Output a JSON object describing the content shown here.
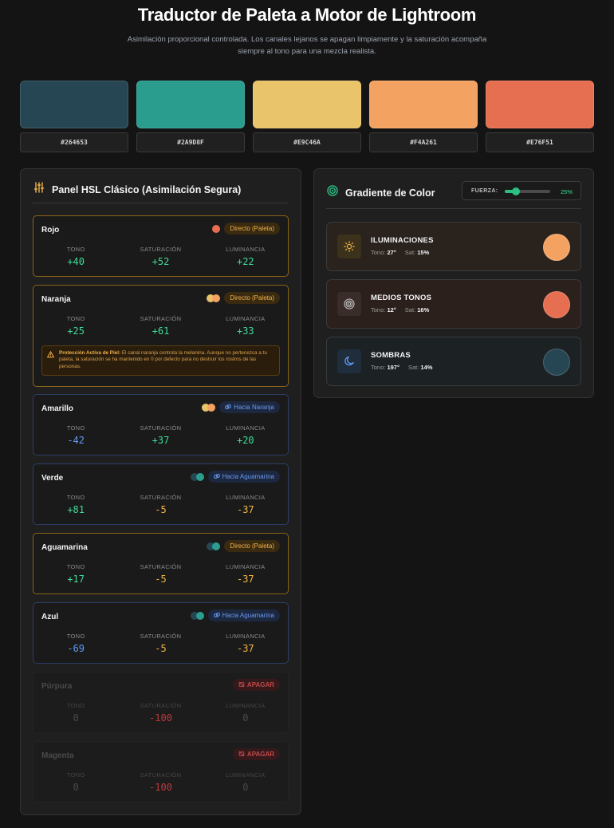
{
  "header": {
    "title": "Traductor de Paleta a Motor de Lightroom",
    "subtitle": "Asimilación proporcional controlada. Los canales lejanos se apagan limpiamente y la saturación acompaña siempre al tono para una mezcla realista."
  },
  "palette": [
    {
      "hex": "#264653",
      "color": "#264653"
    },
    {
      "hex": "#2A9D8F",
      "color": "#2A9D8F"
    },
    {
      "hex": "#E9C46A",
      "color": "#E9C46A"
    },
    {
      "hex": "#F4A261",
      "color": "#F4A261"
    },
    {
      "hex": "#E76F51",
      "color": "#E76F51"
    }
  ],
  "hsl_panel": {
    "title": "Panel HSL Clásico (Asimilación Segura)",
    "col_labels": {
      "hue": "TONO",
      "sat": "SATURACIÓN",
      "lum": "LUMINANCIA"
    },
    "channels": [
      {
        "name": "Rojo",
        "badge": "Directo (Paleta)",
        "state": "direct",
        "hue": "+40",
        "sat": "+52",
        "lum": "+22",
        "dots": [
          "#E76F51"
        ]
      },
      {
        "name": "Naranja",
        "badge": "Directo (Paleta)",
        "state": "direct",
        "hue": "+25",
        "sat": "+61",
        "lum": "+33",
        "dots": [
          "#E9C46A",
          "#F4A261"
        ],
        "warning_title": "Protección Activa de Piel:",
        "warning_text": " El canal naranja controla la melanina. Aunque no pertenezca a tu paleta, la saturación se ha mantenido en 0 por defecto para no destruir los rostros de las personas."
      },
      {
        "name": "Amarillo",
        "badge": "Hacia Naranja",
        "state": "toward",
        "hue": "-42",
        "sat": "+37",
        "lum": "+20",
        "dots": [
          "#E9C46A",
          "#F4A261"
        ]
      },
      {
        "name": "Verde",
        "badge": "Hacia Aguamarina",
        "state": "toward",
        "hue": "+81",
        "sat": "-5",
        "lum": "-37",
        "dots": [
          "#264653",
          "#2A9D8F"
        ]
      },
      {
        "name": "Aguamarina",
        "badge": "Directo (Paleta)",
        "state": "direct",
        "hue": "+17",
        "sat": "-5",
        "lum": "-37",
        "dots": [
          "#264653",
          "#2A9D8F"
        ]
      },
      {
        "name": "Azul",
        "badge": "Hacia Aguamarina",
        "state": "toward",
        "hue": "-69",
        "sat": "-5",
        "lum": "-37",
        "dots": [
          "#264653",
          "#2A9D8F"
        ]
      },
      {
        "name": "Púrpura",
        "badge": "APAGAR",
        "state": "off",
        "hue": "0",
        "sat": "-100",
        "lum": "0",
        "dots": []
      },
      {
        "name": "Magenta",
        "badge": "APAGAR",
        "state": "off",
        "hue": "0",
        "sat": "-100",
        "lum": "0",
        "dots": []
      }
    ]
  },
  "gradient_panel": {
    "title": "Gradiente de Color",
    "force_label": "FUERZA:",
    "force_value": "25%",
    "force_fraction": 0.25,
    "tone_label": "Tono:",
    "sat_label": "Sat:",
    "rows": [
      {
        "name": "ILUMINACIONES",
        "tone": "27°",
        "sat": "15%",
        "color": "#F4A261",
        "icon": "sun-icon"
      },
      {
        "name": "MEDIOS TONOS",
        "tone": "12°",
        "sat": "16%",
        "color": "#E76F51",
        "icon": "target-icon"
      },
      {
        "name": "SOMBRAS",
        "tone": "197°",
        "sat": "14%",
        "color": "#264653",
        "icon": "moon-icon"
      }
    ]
  },
  "colors": {
    "accent_green": "#3ddc97",
    "accent_orange": "#f0b24a",
    "accent_blue": "#6b9cf0",
    "off_red": "#c0393b"
  }
}
